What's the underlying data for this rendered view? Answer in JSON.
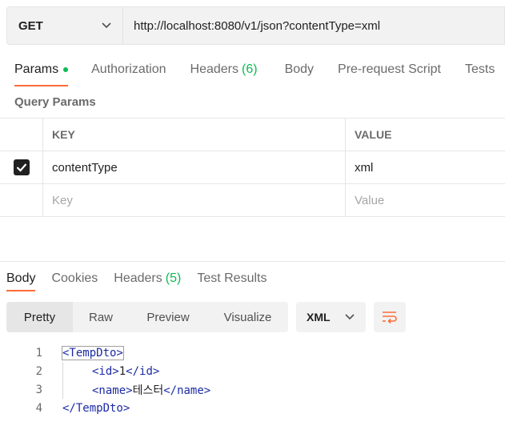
{
  "request": {
    "method": "GET",
    "url": "http://localhost:8080/v1/json?contentType=xml"
  },
  "request_tabs": [
    {
      "label": "Params",
      "active": true
    },
    {
      "label": "Authorization"
    },
    {
      "label": "Headers",
      "count": "(6)"
    },
    {
      "label": "Body"
    },
    {
      "label": "Pre-request Script"
    },
    {
      "label": "Tests"
    }
  ],
  "query_params": {
    "title": "Query Params",
    "header": {
      "key": "KEY",
      "value": "VALUE"
    },
    "rows": [
      {
        "key": "contentType",
        "value": "xml",
        "checked": true
      }
    ],
    "placeholder": {
      "key": "Key",
      "value": "Value"
    }
  },
  "response_tabs": [
    {
      "label": "Body",
      "active": true
    },
    {
      "label": "Cookies"
    },
    {
      "label": "Headers",
      "count": "(5)"
    },
    {
      "label": "Test Results"
    }
  ],
  "view_modes": [
    "Pretty",
    "Raw",
    "Preview",
    "Visualize"
  ],
  "active_view": "Pretty",
  "format": "XML",
  "code_lines": [
    {
      "n": "1",
      "open": "<TempDto>"
    },
    {
      "n": "2",
      "open": "<id>",
      "text": "1",
      "close": "</id>"
    },
    {
      "n": "3",
      "open": "<name>",
      "text": "테스터",
      "close": "</name>"
    },
    {
      "n": "4",
      "open": "</TempDto>"
    }
  ],
  "colors": {
    "accent": "#ff6c37",
    "success": "#0cbb52",
    "xml_tag": "#1c2ba5"
  },
  "icons": {
    "method_dropdown": "chevron-down-icon",
    "format_dropdown": "chevron-down-icon",
    "wrap": "wrap-lines-icon",
    "checkbox": "check-icon"
  }
}
